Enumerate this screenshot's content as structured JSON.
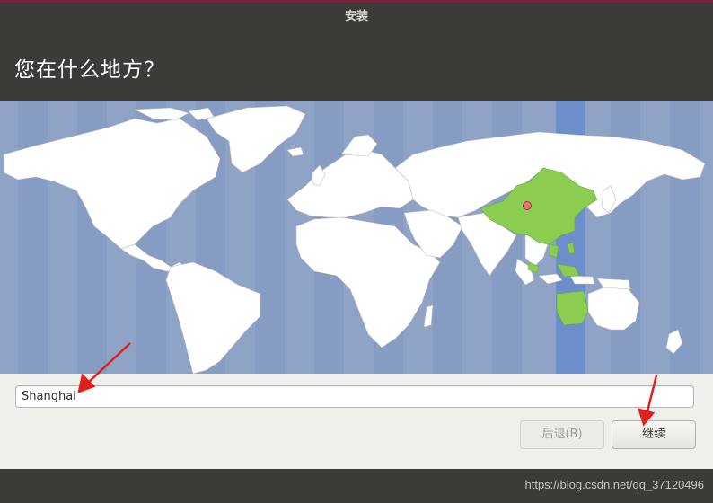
{
  "window": {
    "title": "安装"
  },
  "page": {
    "heading": "您在什么地方？"
  },
  "map": {
    "selected_city": "Shanghai",
    "highlight_color": "#8bcd50",
    "ocean_color": "#8fa3c7",
    "active_zone_color": "#6c8fcc",
    "pin_color": "#e8747a"
  },
  "location": {
    "value": "Shanghai"
  },
  "buttons": {
    "back_label": "后退(B)",
    "continue_label": "继续"
  },
  "footer": {
    "watermark": "https://blog.csdn.net/qq_37120496"
  },
  "annotation": {
    "arrow_color": "#e0201b"
  }
}
